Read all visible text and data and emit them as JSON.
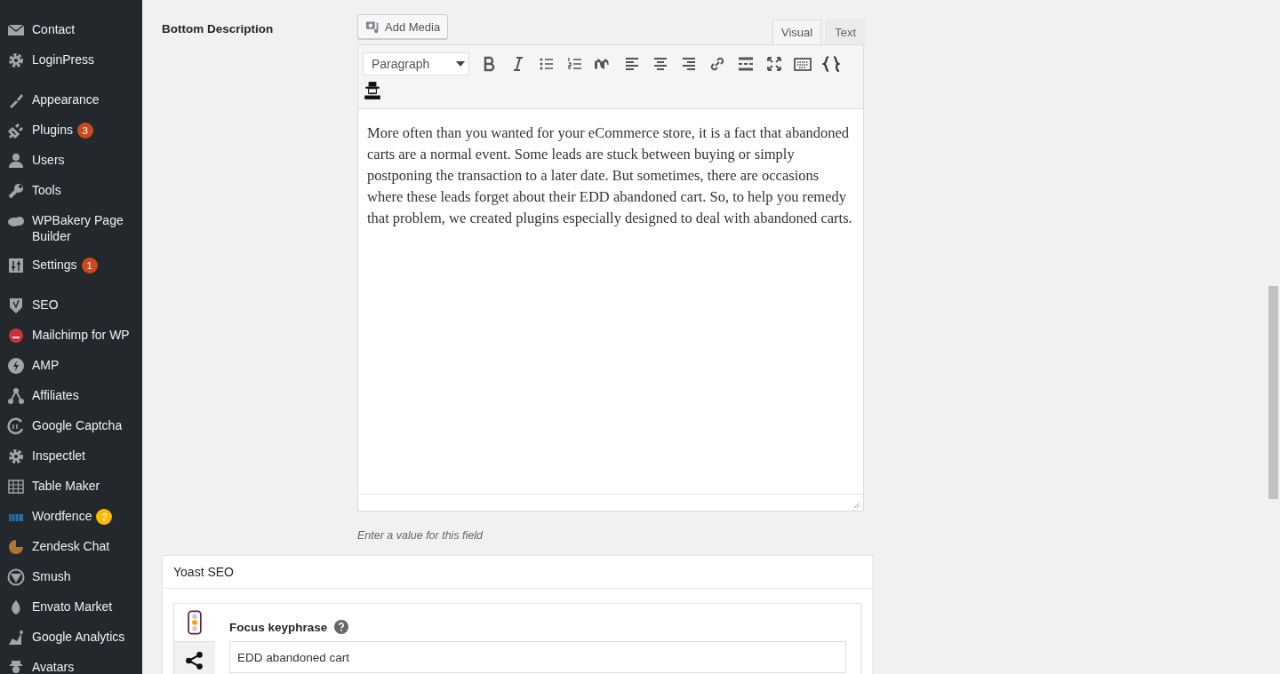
{
  "sidebar": {
    "groups": [
      {
        "items": [
          {
            "label": "Contact"
          },
          {
            "label": "LoginPress"
          }
        ]
      },
      {
        "items": [
          {
            "label": "Appearance"
          },
          {
            "label": "Plugins",
            "badge": {
              "count": "3",
              "color": "#ca4a1f"
            }
          },
          {
            "label": "Users"
          },
          {
            "label": "Tools"
          },
          {
            "label": "WPBakery Page Builder"
          },
          {
            "label": "Settings",
            "badge": {
              "count": "1",
              "color": "#ca4a1f"
            }
          }
        ]
      },
      {
        "items": [
          {
            "label": "SEO"
          },
          {
            "label": "Mailchimp for WP"
          },
          {
            "label": "AMP"
          },
          {
            "label": "Affiliates"
          },
          {
            "label": "Google Captcha"
          },
          {
            "label": "Inspectlet"
          },
          {
            "label": "Table Maker"
          },
          {
            "label": "Wordfence",
            "badge": {
              "count": "2",
              "color": "#ffb900"
            }
          },
          {
            "label": "Zendesk Chat"
          },
          {
            "label": "Smush"
          },
          {
            "label": "Envato Market"
          },
          {
            "label": "Google Analytics"
          },
          {
            "label": "Avatars"
          }
        ]
      }
    ]
  },
  "field": {
    "label": "Bottom Description",
    "add_media": "Add Media",
    "tabs": [
      {
        "label": "Visual",
        "selected": true
      },
      {
        "label": "Text",
        "selected": false
      }
    ],
    "format_select": "Paragraph",
    "content": "More often than you wanted for your eCommerce store, it is a fact that abandoned carts are a normal event. Some leads are stuck between buying or simply postponing the transaction to a later date. But sometimes, there are occasions where these leads forget about their EDD abandoned cart. So, to help you remedy that problem, we created plugins especially designed to deal with abandoned carts.",
    "hint": "Enter a value for this field"
  },
  "yoast": {
    "title": "Yoast SEO",
    "focus_label": "Focus keyphrase",
    "focus_value": "EDD abandoned cart"
  }
}
